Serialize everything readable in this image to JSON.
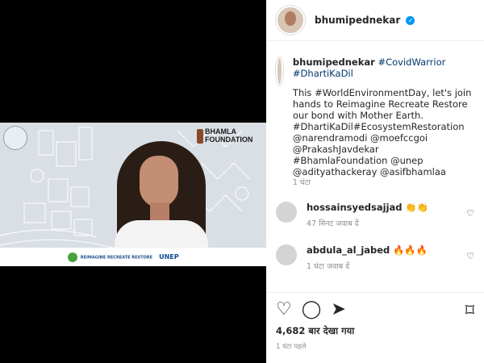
{
  "post": {
    "username": "bhumipednekar",
    "caption_tags": "#CovidWarrior #DhartiKaDil",
    "caption_text": "This #WorldEnvironmentDay, let's join hands to Reimagine Recreate Restore our bond with Mother Earth. #DhartiKaDil#EcosystemRestoration @narendramodi @moefccgoi @PrakashJavdekar #BhamlaFoundation @unep @adityathackeray @asifbhamlaa",
    "caption_age": "1 घंटा"
  },
  "media": {
    "foundation_text": "BHAMLA FOUNDATION",
    "footer_brand": "REIMAGINE RECREATE RESTORE",
    "unep": "UNEP",
    "reimagine_label": "REIMAGINE",
    "recreate_label": "RECREATE",
    "restore_label": "RESTORE"
  },
  "comments": [
    {
      "username": "hossainsyedsajjad",
      "text": "👏👏",
      "meta": "47 मिनट  जवाब दें"
    },
    {
      "username": "abdula_al_jabed",
      "text": "🔥🔥🔥",
      "meta": "1 घंटा  जवाब दें"
    }
  ],
  "actions": {
    "views_label": "4,682 बार देखा गया",
    "time_label": "1 घंटा पहले"
  },
  "icons": {
    "heart": "heart-icon",
    "comment": "comment-icon",
    "share": "share-icon",
    "bookmark": "bookmark-icon"
  }
}
